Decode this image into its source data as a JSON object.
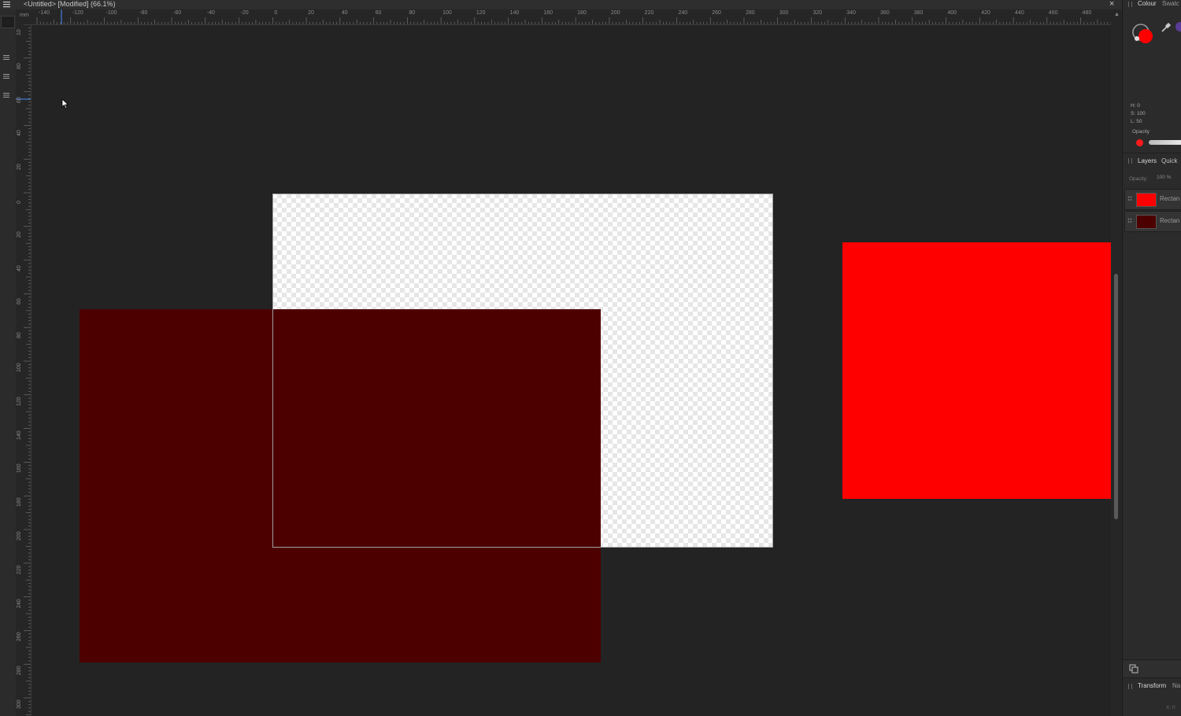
{
  "window": {
    "title": "<Untitled> [Modified] (66.1%)",
    "close_icon": "close-icon",
    "menu_icon": "hamburger-menu-icon"
  },
  "rulers": {
    "unit": "mm",
    "horizontal_labels": [
      "-140",
      "-120",
      "-100",
      "-80",
      "-60",
      "-40",
      "-20",
      "0",
      "20",
      "40",
      "60",
      "80",
      "100",
      "120",
      "140",
      "160",
      "180",
      "200",
      "220",
      "240",
      "260",
      "280",
      "300",
      "320",
      "340",
      "360",
      "380",
      "400",
      "420",
      "440",
      "460",
      "480"
    ],
    "vertical_labels": [
      "10",
      "80",
      "60",
      "40",
      "20",
      "0",
      "20",
      "40",
      "60",
      "80",
      "100",
      "120",
      "140",
      "160",
      "180",
      "200",
      "220",
      "240",
      "260",
      "280",
      "300"
    ]
  },
  "canvas": {
    "background_color": "#232323",
    "artboard_fill": "transparent-checkerboard",
    "shapes": [
      {
        "name": "dark-red-rectangle",
        "color": "#4d0000"
      },
      {
        "name": "red-rectangle",
        "color": "#ff0000"
      }
    ]
  },
  "right_panel": {
    "colour_tab": "Colour",
    "swatches_tab": "Swatc",
    "hsl": {
      "h": "H: 0",
      "s": "S: 100",
      "l": "L: 50"
    },
    "opacity_label": "Opacity",
    "opacity_value": 1.0,
    "fill_color": "#ff0000",
    "layers_tab": "Layers",
    "quick_tab": "Quick",
    "layer_opacity_label": "Opacity:",
    "layer_opacity_value": "100 %",
    "layers": [
      {
        "name": "Rectan",
        "color": "#ff0000"
      },
      {
        "name": "Rectan",
        "color": "#4d0000"
      }
    ],
    "transform_tab": "Transform",
    "navigator_tab": "Na",
    "x_label": "X: 0"
  }
}
